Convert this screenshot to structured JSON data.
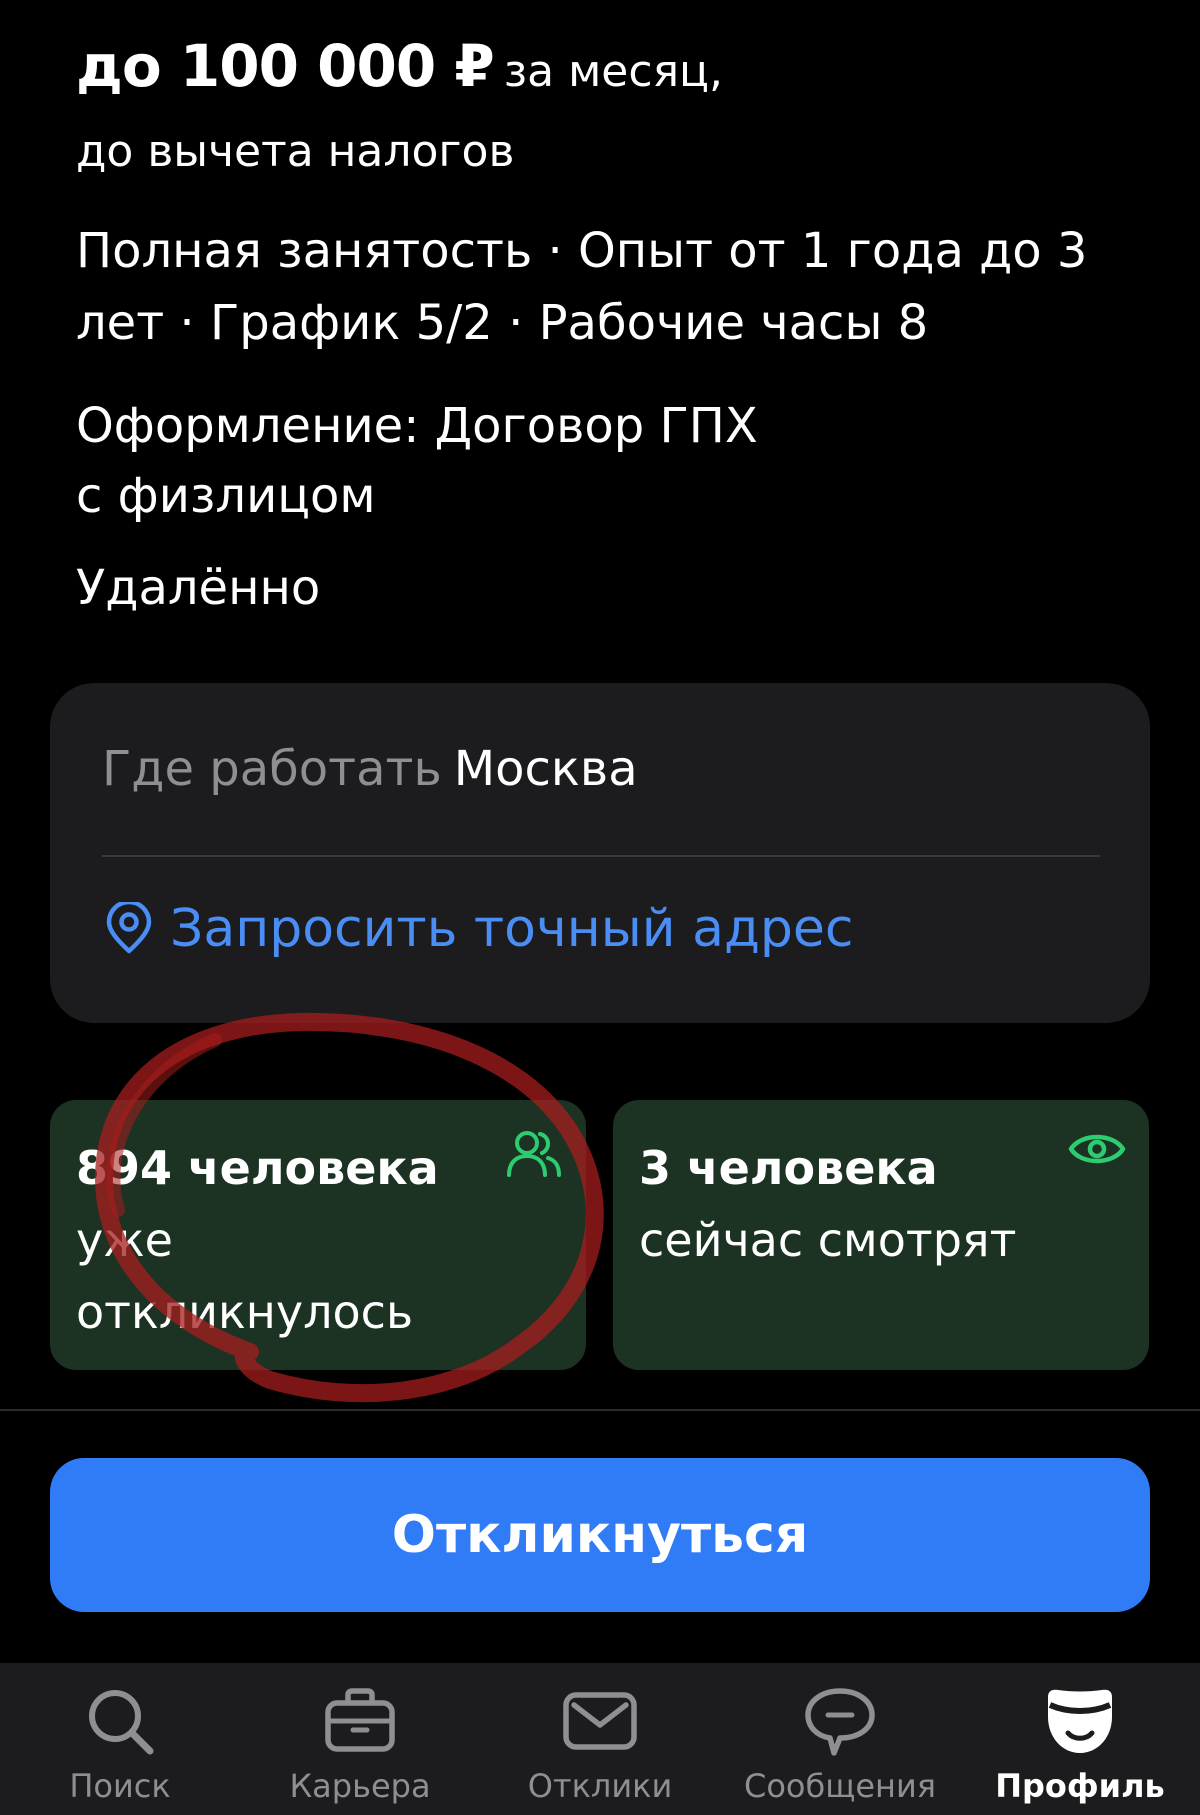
{
  "vacancy": {
    "salary_amount": "до 100 000 ₽",
    "salary_period": "за месяц,",
    "salary_note": "до вычета налогов",
    "conditions": "Полная занятость · Опыт от 1 года до 3 лет · График 5/2 · Рабочие часы 8",
    "employment_line1": "Оформление: Договор ГПХ",
    "employment_line2": "с физлицом",
    "work_format": "Удалённо"
  },
  "location": {
    "label": "Где работать",
    "city": "Москва",
    "request_address": "Запросить точный адрес",
    "link_color": "#4a8ef5"
  },
  "stats": {
    "responses": {
      "count": "894 человека",
      "line2": "уже",
      "line3": "откликнулось",
      "icon": "people-icon"
    },
    "viewers": {
      "count": "3 человека",
      "line2": "сейчас смотрят",
      "icon": "eye-icon"
    },
    "accent_color": "#2ecc71"
  },
  "annotation_color": "#a51d1d",
  "actions": {
    "respond_label": "Откликнуться",
    "button_color": "#2f7cf6"
  },
  "tabbar": {
    "items": [
      {
        "label": "Поиск",
        "icon": "search-icon",
        "active": false
      },
      {
        "label": "Карьера",
        "icon": "briefcase-icon",
        "active": false
      },
      {
        "label": "Отклики",
        "icon": "envelope-icon",
        "active": false
      },
      {
        "label": "Сообщения",
        "icon": "chat-bubble-icon",
        "active": false
      },
      {
        "label": "Профиль",
        "icon": "profile-icon",
        "active": true
      }
    ]
  }
}
